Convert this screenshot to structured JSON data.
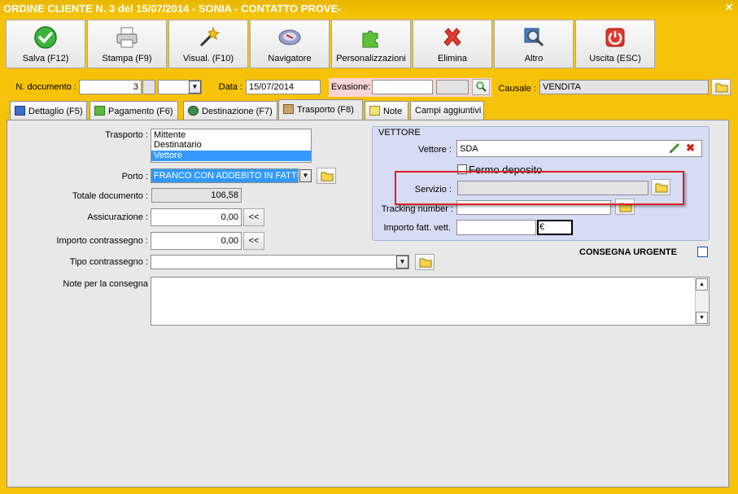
{
  "window": {
    "title": "ORDINE CLIENTE N. 3 del 15/07/2014 - SONIA - CONTATTO PROVE-"
  },
  "toolbar": [
    {
      "label": "Salva (F12)",
      "icon": "check-icon"
    },
    {
      "label": "Stampa (F9)",
      "icon": "printer-icon"
    },
    {
      "label": "Visual. (F10)",
      "icon": "magic-wand-icon"
    },
    {
      "label": "Navigatore",
      "icon": "compass-icon"
    },
    {
      "label": "Personalizzazioni",
      "icon": "puzzle-icon"
    },
    {
      "label": "Elimina",
      "icon": "delete-x-icon"
    },
    {
      "label": "Altro",
      "icon": "magnifier-icon"
    },
    {
      "label": "Uscita (ESC)",
      "icon": "power-icon"
    }
  ],
  "header": {
    "n_documento_label": "N. documento :",
    "n_documento_value": "3",
    "data_label": "Data :",
    "data_value": "15/07/2014",
    "evasione_label": "Evasione:",
    "evasione_value": "",
    "causale_label": "Causale :",
    "causale_value": "VENDITA"
  },
  "tabs": [
    {
      "label": "Dettaglio (F5)",
      "icon": "detail-icon"
    },
    {
      "label": "Pagamento (F6)",
      "icon": "money-icon"
    },
    {
      "label": "Destinazione (F7)",
      "icon": "globe-icon"
    },
    {
      "label": "Trasporto (F8)",
      "icon": "truck-icon",
      "active": true
    },
    {
      "label": "Note",
      "icon": "note-icon"
    },
    {
      "label": "Campi aggiuntivi",
      "icon": ""
    }
  ],
  "transport": {
    "trasporto_label": "Trasporto :",
    "trasporto_options": [
      "Mittente",
      "Destinatario",
      "Vettore"
    ],
    "trasporto_selected": "Vettore",
    "porto_label": "Porto :",
    "porto_value": "FRANCO CON ADDEBITO IN FATTURA",
    "totale_label": "Totale documento :",
    "totale_value": "106,58",
    "assicurazione_label": "Assicurazione :",
    "assicurazione_value": "0,00",
    "importo_contrassegno_label": "Importo contrassegno :",
    "importo_contrassegno_value": "0,00",
    "tipo_contrassegno_label": "Tipo contrassegno :",
    "tipo_contrassegno_value": "",
    "note_consegna_label": "Note per la consegna",
    "note_consegna_value": "",
    "back_button_label": "<<"
  },
  "vettore": {
    "group_title": "VETTORE",
    "vettore_label": "Vettore :",
    "vettore_value": "SDA",
    "fermo_deposito_label": "Fermo deposito",
    "servizio_label": "Servizio :",
    "servizio_value": "",
    "tracking_label": "Tracking number :",
    "tracking_value": "",
    "importo_fatt_label": "Importo fatt. vett.",
    "importo_fatt_value": "",
    "currency": "€",
    "consegna_urgente_label": "CONSEGNA URGENTE"
  },
  "colors": {
    "window_bg": "#f7c20a",
    "panel_bg": "#e8e8e8",
    "group_bg": "#d6dcf4",
    "selection": "#3399ff",
    "highlight_box": "#e02020"
  }
}
